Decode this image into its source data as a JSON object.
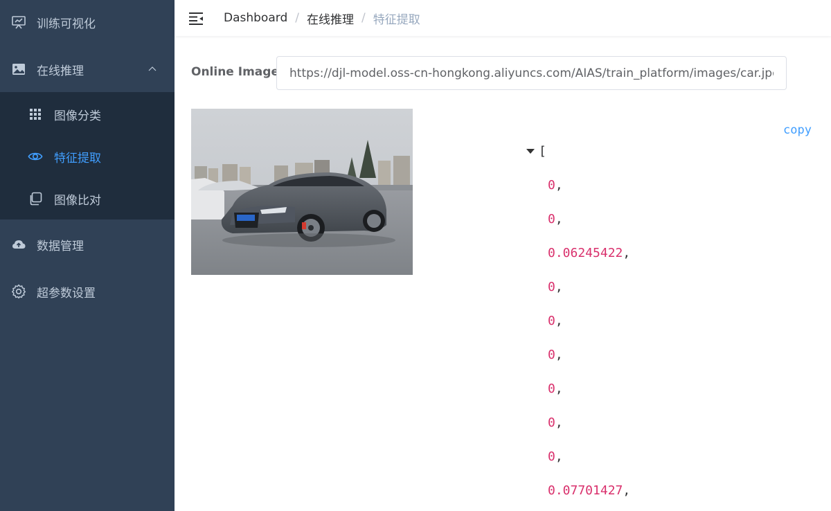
{
  "sidebar": {
    "items": [
      {
        "label": "训练可视化",
        "icon": "presentation-chart-icon"
      },
      {
        "label": "在线推理",
        "icon": "picture-icon",
        "expanded": true
      },
      {
        "label": "数据管理",
        "icon": "cloud-upload-icon"
      },
      {
        "label": "超参数设置",
        "icon": "gear-icon"
      }
    ],
    "submenu": [
      {
        "label": "图像分类",
        "icon": "grid-icon"
      },
      {
        "label": "特征提取",
        "icon": "eye-icon",
        "active": true
      },
      {
        "label": "图像比对",
        "icon": "copy-icon"
      }
    ]
  },
  "navbar": {
    "breadcrumb": [
      "Dashboard",
      "在线推理",
      "特征提取"
    ]
  },
  "form": {
    "label": "Online Image",
    "url": "https://djl-model.oss-cn-hongkong.aliyuncs.com/AIAS/train_platform/images/car.jpeg"
  },
  "result": {
    "copy_label": "copy",
    "open_bracket": "[",
    "values": [
      "0",
      "0",
      "0.06245422",
      "0",
      "0",
      "0",
      "0",
      "0",
      "0",
      "0.07701427"
    ]
  },
  "colors": {
    "sidebar_bg": "#304156",
    "submenu_bg": "#1f2d3d",
    "active": "#409eff",
    "json_number": "#d9306c"
  }
}
